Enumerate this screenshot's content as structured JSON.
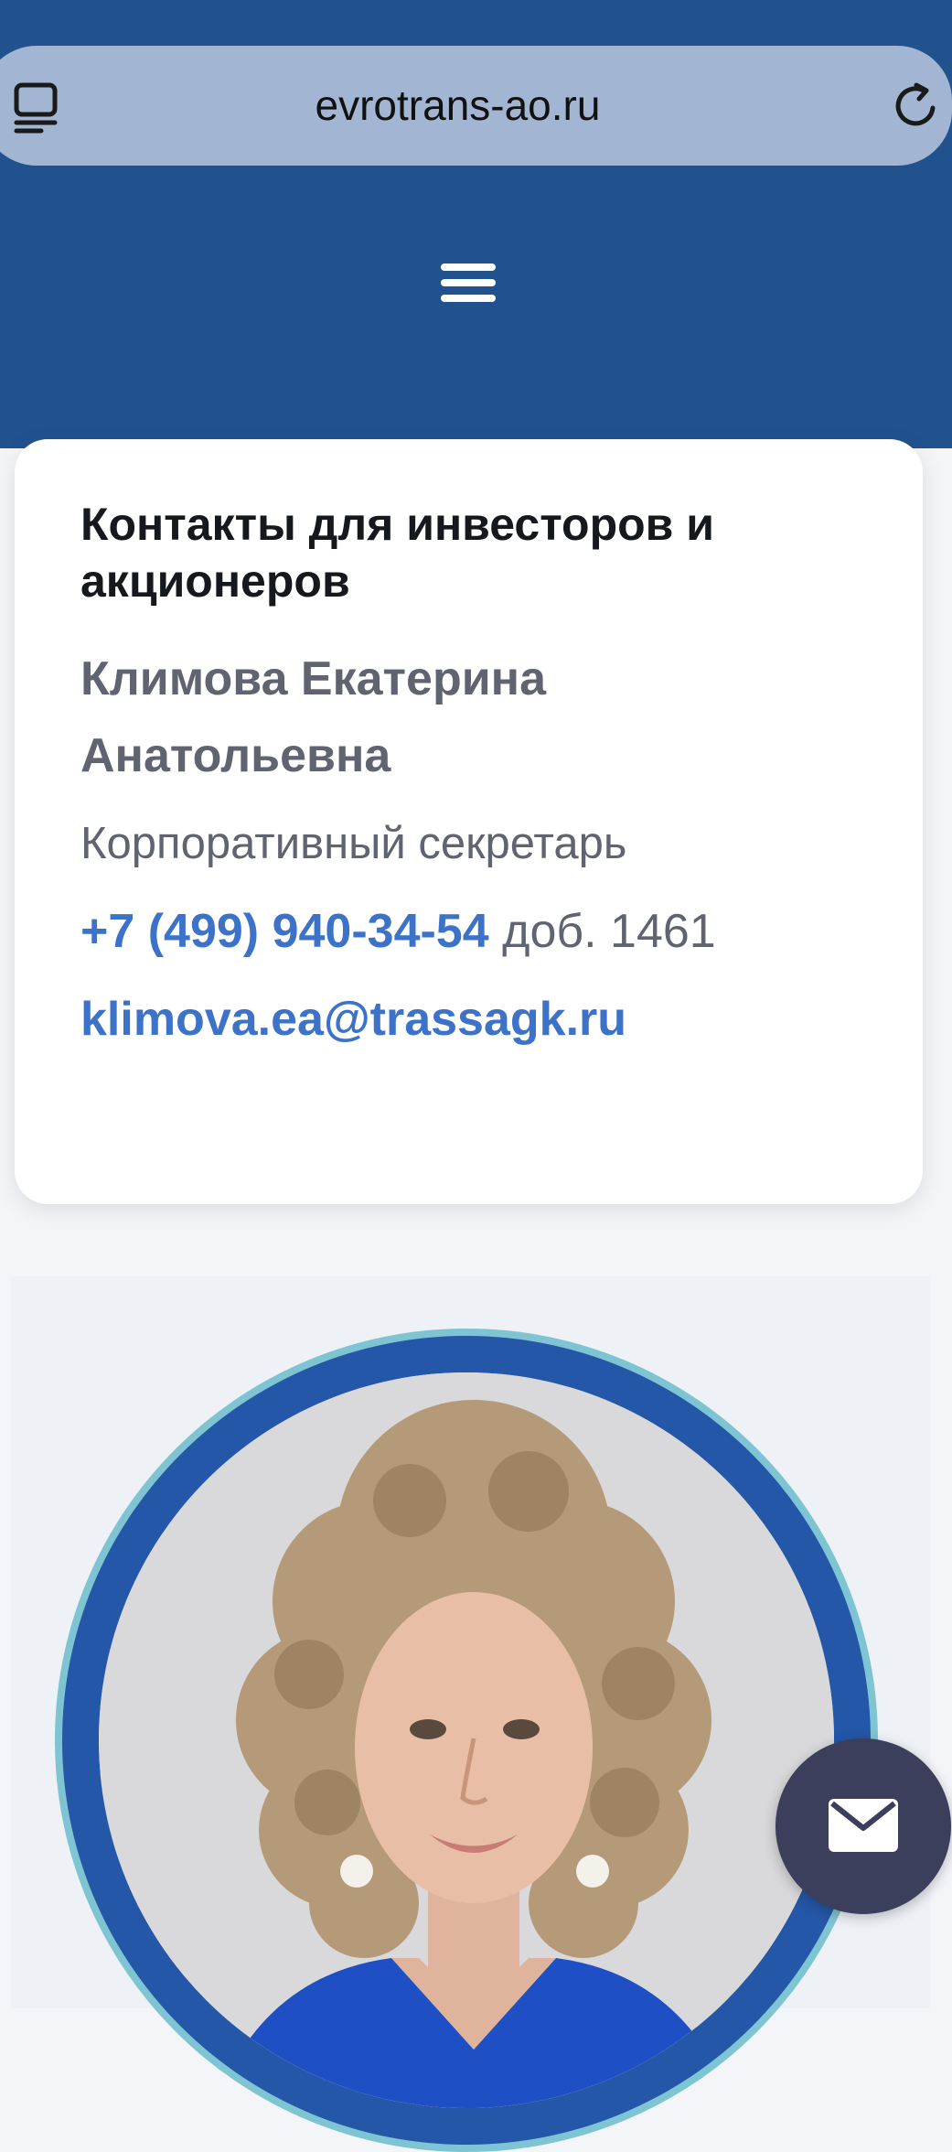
{
  "browser": {
    "url": "evrotrans-ao.ru",
    "tabs_icon": "tabs-icon",
    "reload_icon": "reload-icon"
  },
  "header": {
    "menu_icon": "hamburger-menu-icon",
    "background": "#22528e"
  },
  "contact_card": {
    "title": "Контакты для инвесторов и акционеров",
    "name_line1": "Климова Екатерина",
    "name_line2": "Анатольевна",
    "role": "Корпоративный секретарь",
    "phone": "+7 (499) 940-34-54",
    "phone_ext": "доб. 1461",
    "email": "klimova.ea@trassagk.ru"
  },
  "colors": {
    "accent_link": "#3d72c9",
    "muted_text": "#5f6470",
    "ring_outer": "#7fc4d3",
    "ring_inner": "#2457a8",
    "fab": "#3b3f5c"
  },
  "fab": {
    "icon": "mail-icon"
  }
}
